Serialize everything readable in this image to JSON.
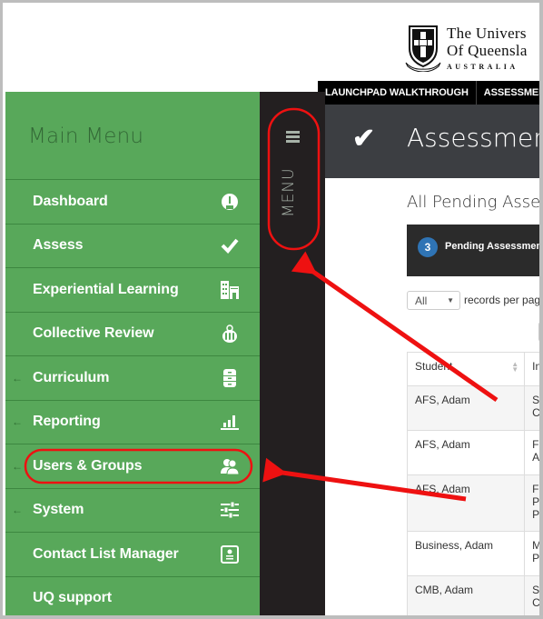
{
  "header": {
    "logo": {
      "line1": "The Univers",
      "line2": "Of Queensla",
      "line3": "AUSTRALIA"
    },
    "topnav": [
      "LAUNCHPAD WALKTHROUGH",
      "ASSESSMENT"
    ]
  },
  "sidebar": {
    "title": "Main Menu",
    "items": [
      {
        "label": "Dashboard",
        "icon": "dashboard-gauge-icon",
        "has_arrow": false
      },
      {
        "label": "Assess",
        "icon": "check-icon",
        "has_arrow": false
      },
      {
        "label": "Experiential Learning",
        "icon": "buildings-icon",
        "has_arrow": false
      },
      {
        "label": "Collective Review",
        "icon": "group-review-icon",
        "has_arrow": false
      },
      {
        "label": "Curriculum",
        "icon": "filing-cabinet-icon",
        "has_arrow": true
      },
      {
        "label": "Reporting",
        "icon": "bar-chart-icon",
        "has_arrow": true
      },
      {
        "label": "Users & Groups",
        "icon": "users-icon",
        "has_arrow": true
      },
      {
        "label": "System",
        "icon": "sliders-icon",
        "has_arrow": true
      },
      {
        "label": "Contact List Manager",
        "icon": "contact-card-icon",
        "has_arrow": false
      },
      {
        "label": "UQ support",
        "icon": "",
        "has_arrow": false
      }
    ],
    "arrow_glyph": "←"
  },
  "strip": {
    "menu_label": "MENU"
  },
  "content": {
    "header_title": "Assessment",
    "subtitle": "All Pending Asse",
    "pending": {
      "count": "3",
      "label": "Pending Assessmen"
    },
    "page_size": {
      "value": "All",
      "suffix": "records per pag"
    },
    "table": {
      "headers": [
        "Student",
        "In"
      ],
      "rows": [
        {
          "student": "AFS, Adam",
          "col2": [
            "SC",
            "Co"
          ]
        },
        {
          "student": "AFS, Adam",
          "col2": [
            "FO",
            "As"
          ]
        },
        {
          "student": "AFS, Adam",
          "col2": [
            "FO",
            "Pr",
            "Pr"
          ]
        },
        {
          "student": "Business, Adam",
          "col2": [
            "MI",
            "Po"
          ]
        },
        {
          "student": "CMB, Adam",
          "col2": [
            "SC",
            "Co"
          ]
        }
      ]
    }
  },
  "annotations": {
    "color": "#ee1111",
    "highlights": [
      "menu-toggle",
      "users-groups-item"
    ]
  }
}
